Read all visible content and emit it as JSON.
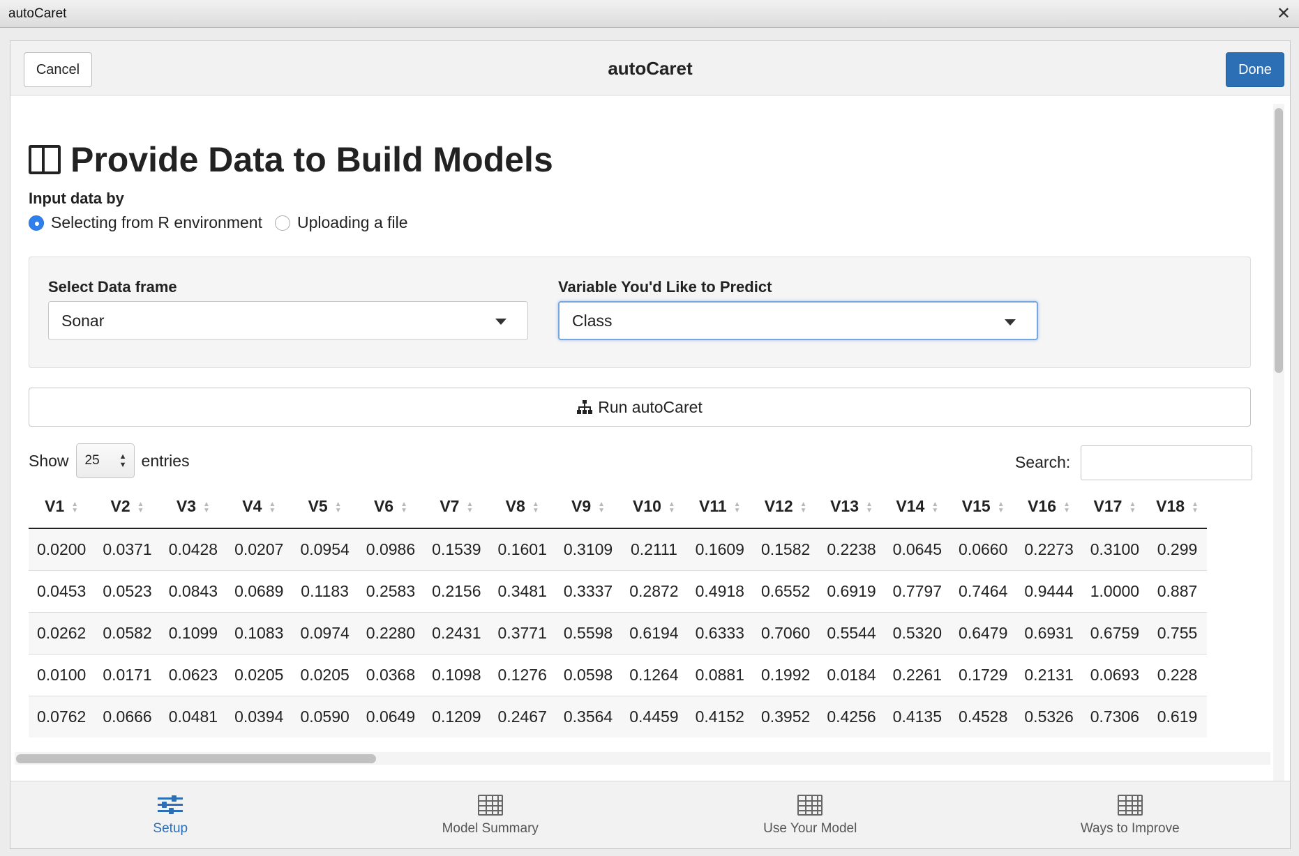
{
  "window": {
    "title": "autoCaret",
    "close_glyph": "✕"
  },
  "header": {
    "cancel_label": "Cancel",
    "title": "autoCaret",
    "done_label": "Done"
  },
  "page": {
    "heading": "Provide Data to Build Models",
    "heading_icon": "columns-icon",
    "input_label": "Input data by",
    "radio_options": [
      {
        "label": "Selecting from R environment",
        "checked": true
      },
      {
        "label": "Uploading a file",
        "checked": false
      }
    ],
    "data_frame_label": "Select Data frame",
    "data_frame_value": "Sonar",
    "predict_label": "Variable You'd Like to Predict",
    "predict_value": "Class",
    "run_label": "Run autoCaret"
  },
  "table_controls": {
    "show_label": "Show",
    "page_length": "25",
    "entries_label": "entries",
    "search_label": "Search:",
    "search_value": ""
  },
  "table": {
    "columns": [
      "V1",
      "V2",
      "V3",
      "V4",
      "V5",
      "V6",
      "V7",
      "V8",
      "V9",
      "V10",
      "V11",
      "V12",
      "V13",
      "V14",
      "V15",
      "V16",
      "V17",
      "V18"
    ],
    "rows": [
      [
        "0.0200",
        "0.0371",
        "0.0428",
        "0.0207",
        "0.0954",
        "0.0986",
        "0.1539",
        "0.1601",
        "0.3109",
        "0.2111",
        "0.1609",
        "0.1582",
        "0.2238",
        "0.0645",
        "0.0660",
        "0.2273",
        "0.3100",
        "0.299"
      ],
      [
        "0.0453",
        "0.0523",
        "0.0843",
        "0.0689",
        "0.1183",
        "0.2583",
        "0.2156",
        "0.3481",
        "0.3337",
        "0.2872",
        "0.4918",
        "0.6552",
        "0.6919",
        "0.7797",
        "0.7464",
        "0.9444",
        "1.0000",
        "0.887"
      ],
      [
        "0.0262",
        "0.0582",
        "0.1099",
        "0.1083",
        "0.0974",
        "0.2280",
        "0.2431",
        "0.3771",
        "0.5598",
        "0.6194",
        "0.6333",
        "0.7060",
        "0.5544",
        "0.5320",
        "0.6479",
        "0.6931",
        "0.6759",
        "0.755"
      ],
      [
        "0.0100",
        "0.0171",
        "0.0623",
        "0.0205",
        "0.0205",
        "0.0368",
        "0.1098",
        "0.1276",
        "0.0598",
        "0.1264",
        "0.0881",
        "0.1992",
        "0.0184",
        "0.2261",
        "0.1729",
        "0.2131",
        "0.0693",
        "0.228"
      ],
      [
        "0.0762",
        "0.0666",
        "0.0481",
        "0.0394",
        "0.0590",
        "0.0649",
        "0.1209",
        "0.2467",
        "0.3564",
        "0.4459",
        "0.4152",
        "0.3952",
        "0.4256",
        "0.4135",
        "0.4528",
        "0.5326",
        "0.7306",
        "0.619"
      ]
    ]
  },
  "tabs": [
    {
      "label": "Setup",
      "icon": "sliders-icon",
      "active": true
    },
    {
      "label": "Model Summary",
      "icon": "table-icon",
      "active": false
    },
    {
      "label": "Use Your Model",
      "icon": "table-icon",
      "active": false
    },
    {
      "label": "Ways to Improve",
      "icon": "table-icon",
      "active": false
    }
  ],
  "colors": {
    "accent": "#2c6fb4",
    "radio_selected": "#2f80ed"
  }
}
